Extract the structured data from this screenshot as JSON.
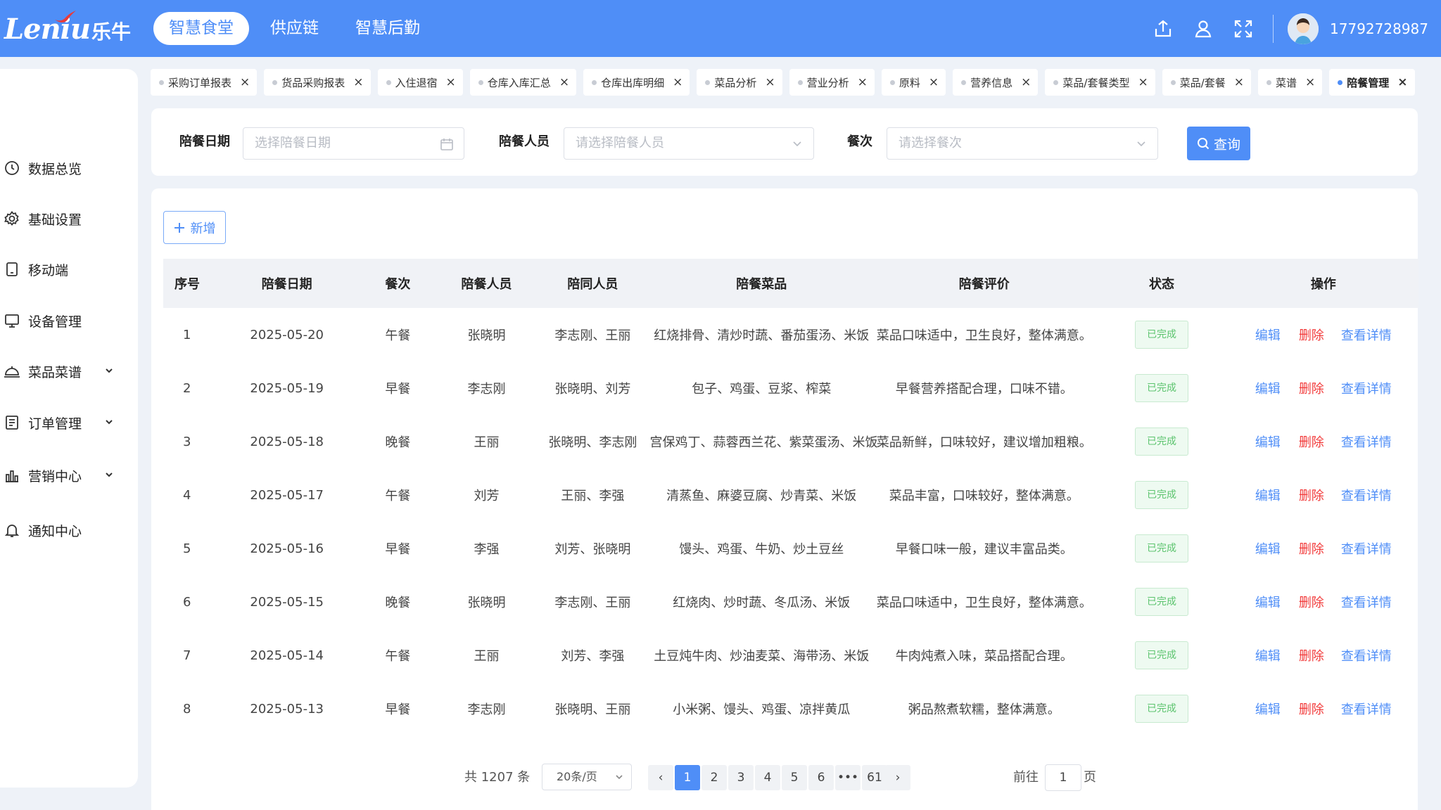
{
  "header": {
    "logo_text": "Leniu",
    "logo_cn": "乐牛",
    "nav": [
      {
        "label": "智慧食堂",
        "active": true
      },
      {
        "label": "供应链",
        "active": false
      },
      {
        "label": "智慧后勤",
        "active": false
      }
    ],
    "phone": "17792728987",
    "icons": [
      "export-icon",
      "user-icon",
      "fullscreen-icon"
    ]
  },
  "sidebar": {
    "items": [
      {
        "label": "数据总览",
        "icon": "clock-icon",
        "expandable": false
      },
      {
        "label": "基础设置",
        "icon": "gear-icon",
        "expandable": false
      },
      {
        "label": "移动端",
        "icon": "tablet-icon",
        "expandable": false
      },
      {
        "label": "设备管理",
        "icon": "monitor-icon",
        "expandable": false
      },
      {
        "label": "菜品菜谱",
        "icon": "cloche-icon",
        "expandable": true
      },
      {
        "label": "订单管理",
        "icon": "document-icon",
        "expandable": true
      },
      {
        "label": "营销中心",
        "icon": "bar-chart-icon",
        "expandable": true
      },
      {
        "label": "通知中心",
        "icon": "bell-icon",
        "expandable": false
      }
    ]
  },
  "tabs": [
    {
      "label": "采购订单报表",
      "active": false
    },
    {
      "label": "货品采购报表",
      "active": false
    },
    {
      "label": "入住退宿",
      "active": false
    },
    {
      "label": "仓库入库汇总",
      "active": false
    },
    {
      "label": "仓库出库明细",
      "active": false
    },
    {
      "label": "菜品分析",
      "active": false
    },
    {
      "label": "营业分析",
      "active": false
    },
    {
      "label": "原料",
      "active": false
    },
    {
      "label": "营养信息",
      "active": false
    },
    {
      "label": "菜品/套餐类型",
      "active": false
    },
    {
      "label": "菜品/套餐",
      "active": false
    },
    {
      "label": "菜谱",
      "active": false
    },
    {
      "label": "陪餐管理",
      "active": true
    }
  ],
  "filters": {
    "date_label": "陪餐日期",
    "date_placeholder": "选择陪餐日期",
    "person_label": "陪餐人员",
    "person_placeholder": "请选择陪餐人员",
    "meal_label": "餐次",
    "meal_placeholder": "请选择餐次",
    "query_label": "查询"
  },
  "toolbar": {
    "add_label": "新增"
  },
  "table": {
    "columns": [
      "序号",
      "陪餐日期",
      "餐次",
      "陪餐人员",
      "陪同人员",
      "陪餐菜品",
      "陪餐评价",
      "状态",
      "操作"
    ],
    "actions": {
      "edit": "编辑",
      "delete": "删除",
      "view": "查看详情"
    },
    "rows": [
      {
        "no": "1",
        "date": "2025-05-20",
        "meal": "午餐",
        "person": "张晓明",
        "companions": "李志刚、王丽",
        "dishes": "红烧排骨、清炒时蔬、番茄蛋汤、米饭",
        "review": "菜品口味适中，卫生良好，整体满意。",
        "status": "已完成"
      },
      {
        "no": "2",
        "date": "2025-05-19",
        "meal": "早餐",
        "person": "李志刚",
        "companions": "张晓明、刘芳",
        "dishes": "包子、鸡蛋、豆浆、榨菜",
        "review": "早餐营养搭配合理，口味不错。",
        "status": "已完成"
      },
      {
        "no": "3",
        "date": "2025-05-18",
        "meal": "晚餐",
        "person": "王丽",
        "companions": "张晓明、李志刚",
        "dishes": "宫保鸡丁、蒜蓉西兰花、紫菜蛋汤、米饭",
        "review": "菜品新鲜，口味较好，建议增加粗粮。",
        "status": "已完成"
      },
      {
        "no": "4",
        "date": "2025-05-17",
        "meal": "午餐",
        "person": "刘芳",
        "companions": "王丽、李强",
        "dishes": "清蒸鱼、麻婆豆腐、炒青菜、米饭",
        "review": "菜品丰富，口味较好，整体满意。",
        "status": "已完成"
      },
      {
        "no": "5",
        "date": "2025-05-16",
        "meal": "早餐",
        "person": "李强",
        "companions": "刘芳、张晓明",
        "dishes": "馒头、鸡蛋、牛奶、炒土豆丝",
        "review": "早餐口味一般，建议丰富品类。",
        "status": "已完成"
      },
      {
        "no": "6",
        "date": "2025-05-15",
        "meal": "晚餐",
        "person": "张晓明",
        "companions": "李志刚、王丽",
        "dishes": "红烧肉、炒时蔬、冬瓜汤、米饭",
        "review": "菜品口味适中，卫生良好，整体满意。",
        "status": "已完成"
      },
      {
        "no": "7",
        "date": "2025-05-14",
        "meal": "午餐",
        "person": "王丽",
        "companions": "刘芳、李强",
        "dishes": "土豆炖牛肉、炒油麦菜、海带汤、米饭",
        "review": "牛肉炖煮入味，菜品搭配合理。",
        "status": "已完成"
      },
      {
        "no": "8",
        "date": "2025-05-13",
        "meal": "早餐",
        "person": "李志刚",
        "companions": "张晓明、王丽",
        "dishes": "小米粥、馒头、鸡蛋、凉拌黄瓜",
        "review": "粥品熬煮软糯，整体满意。",
        "status": "已完成"
      }
    ]
  },
  "pagination": {
    "total_text": "共 1207 条",
    "page_size": "20条/页",
    "pages": [
      "1",
      "2",
      "3",
      "4",
      "5",
      "6",
      "•••",
      "61"
    ],
    "current": "1",
    "prev": "‹",
    "next": "›",
    "goto_prefix": "前往",
    "goto_value": "1",
    "goto_suffix": "页"
  }
}
